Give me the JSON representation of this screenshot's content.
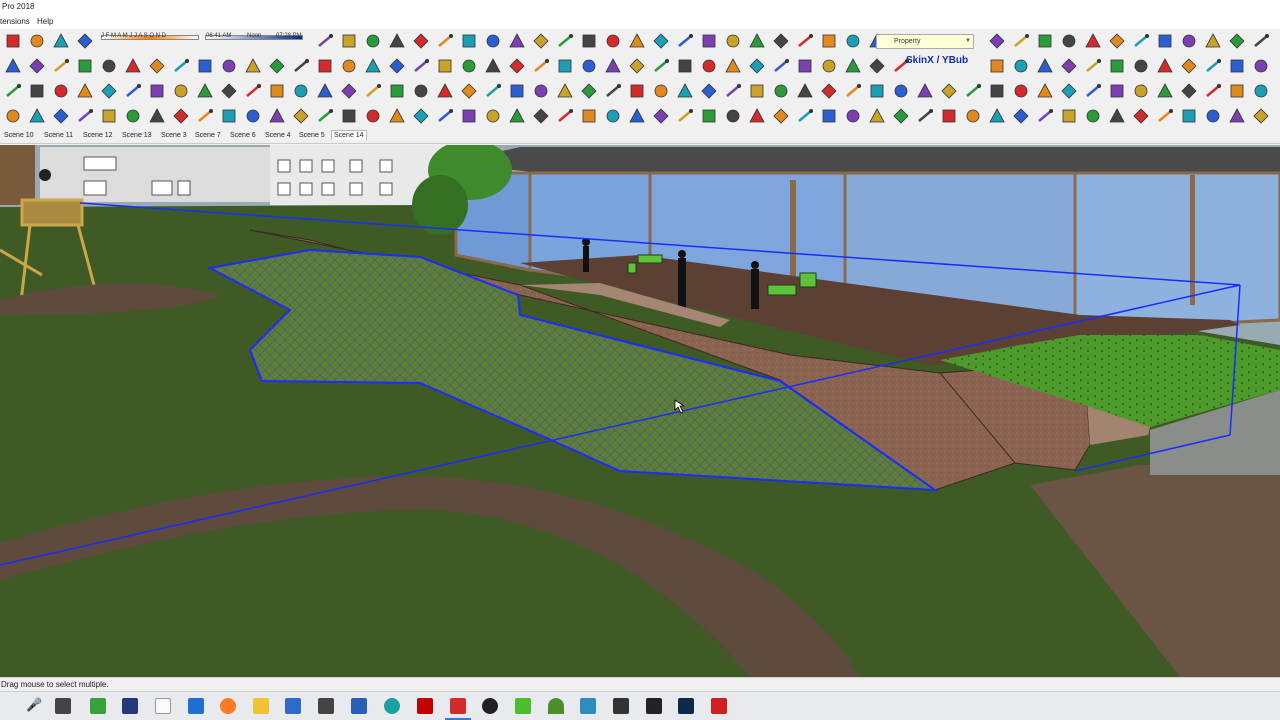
{
  "window": {
    "title": "Pro 2018"
  },
  "menu": {
    "items": [
      "tensions",
      "Help"
    ]
  },
  "shadow": {
    "months": "J F M A M J J A S O N D",
    "time_start": "06:41 AM",
    "time_noon": "Noon",
    "time_end": "07:28 PM"
  },
  "toolbar": {
    "property_dropdown": "Property",
    "skin_label": "SkinX / YBub"
  },
  "scenes": {
    "tabs": [
      "Scene 10",
      "Scene 11",
      "Scene 12",
      "Scene 13",
      "Scene 3",
      "Scene 7",
      "Scene 6",
      "Scene 4",
      "Scene 5",
      "Scene 14"
    ],
    "active": "Scene 14"
  },
  "status": {
    "message": "Drag mouse to select multiple."
  },
  "colors": {
    "selection": "#1a2cff",
    "grass": "#3f5a24",
    "path": "#5f4a3e",
    "wall": "#8a6450",
    "glass": "#6f9ad6",
    "deck": "#5c4034"
  }
}
